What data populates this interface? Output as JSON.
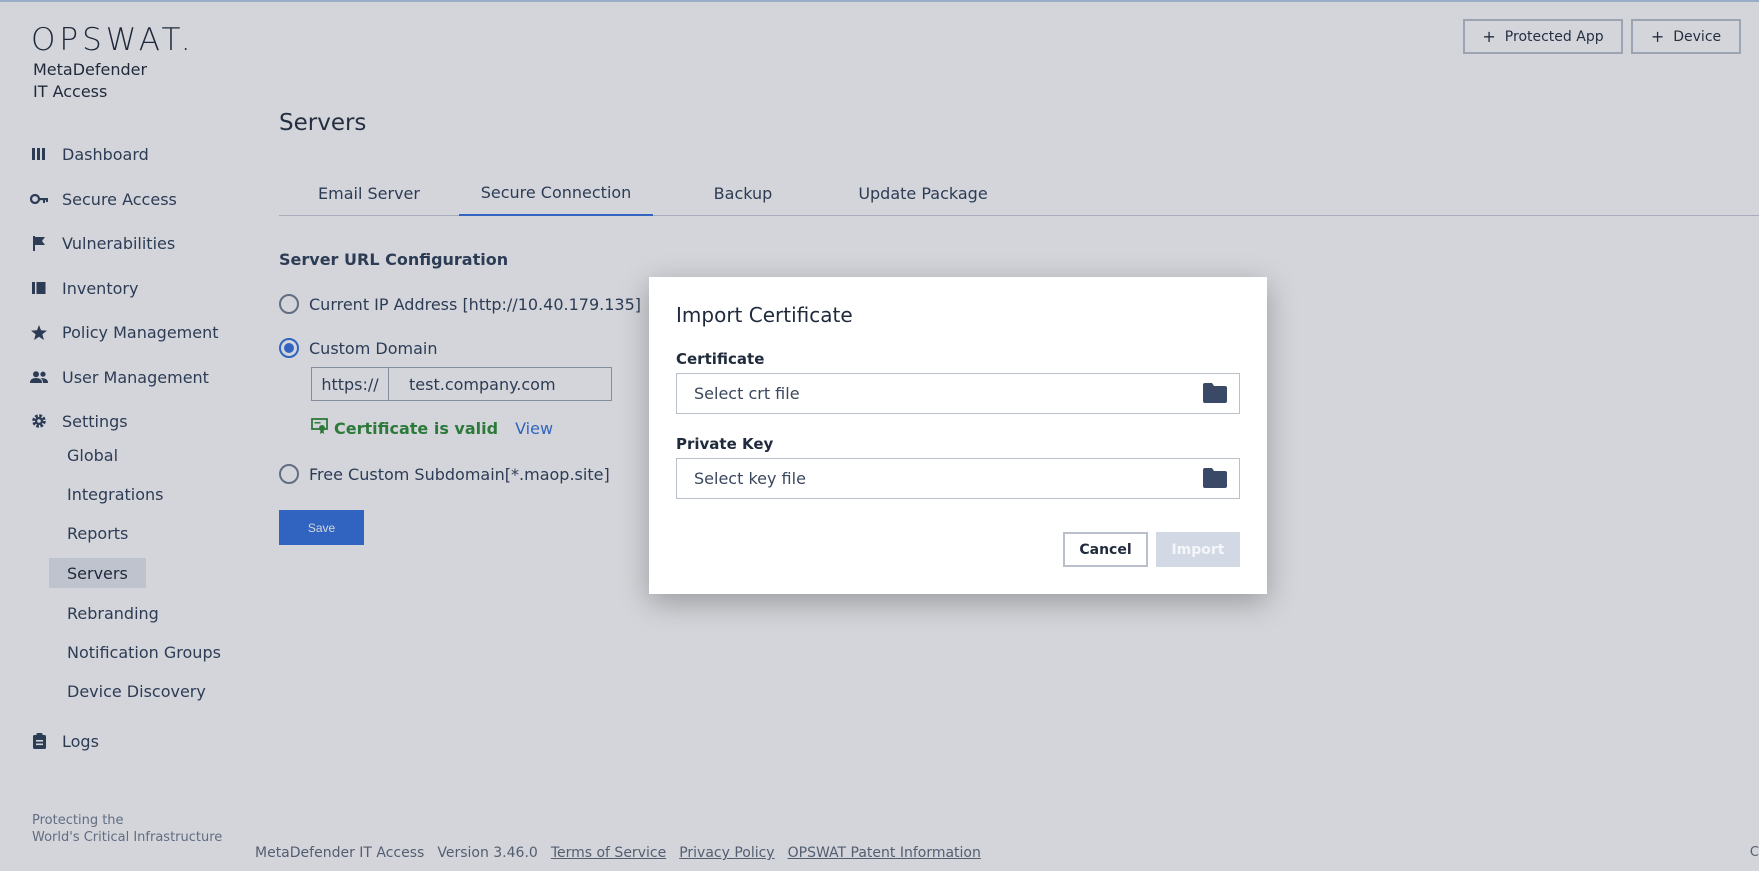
{
  "brand": {
    "logo": "OPSWAT.",
    "product_line1": "MetaDefender",
    "product_line2": "IT Access",
    "tagline_line1": "Protecting the",
    "tagline_line2": "World's Critical Infrastructure"
  },
  "sidebar": {
    "items": [
      {
        "label": "Dashboard",
        "icon": "dashboard-icon"
      },
      {
        "label": "Secure Access",
        "icon": "key-icon"
      },
      {
        "label": "Vulnerabilities",
        "icon": "flag-icon"
      },
      {
        "label": "Inventory",
        "icon": "inventory-icon"
      },
      {
        "label": "Policy Management",
        "icon": "star-icon"
      },
      {
        "label": "User Management",
        "icon": "users-icon"
      },
      {
        "label": "Settings",
        "icon": "gear-icon"
      }
    ],
    "settings_children": [
      "Global",
      "Integrations",
      "Reports",
      "Servers",
      "Rebranding",
      "Notification Groups",
      "Device Discovery"
    ],
    "active_child": "Servers",
    "logs": {
      "label": "Logs",
      "icon": "clipboard-icon"
    }
  },
  "header": {
    "protected_app_label": "Protected App",
    "device_label": "Device"
  },
  "main": {
    "title": "Servers",
    "tabs": [
      {
        "label": "Email Server"
      },
      {
        "label": "Secure Connection"
      },
      {
        "label": "Backup"
      },
      {
        "label": "Update Package"
      }
    ],
    "active_tab": "Secure Connection",
    "section_title": "Server URL Configuration",
    "options": {
      "current_ip": "Current IP Address [http://10.40.179.135]",
      "custom_domain": "Custom Domain",
      "free_subdomain": "Free Custom Subdomain[*.maop.site]"
    },
    "selected_option": "Custom Domain",
    "url_prefix": "https://",
    "domain_value": "test.company.com",
    "cert_status": "Certificate is valid",
    "view_link": "View",
    "save_label": "Save"
  },
  "modal": {
    "title": "Import Certificate",
    "certificate_label": "Certificate",
    "certificate_placeholder": "Select crt file",
    "private_key_label": "Private Key",
    "private_key_placeholder": "Select key file",
    "cancel_label": "Cancel",
    "import_label": "Import"
  },
  "footer": {
    "product": "MetaDefender IT Access",
    "version": "Version 3.46.0",
    "terms": "Terms of Service",
    "privacy": "Privacy Policy",
    "patent": "OPSWAT Patent Information",
    "corner": "C"
  },
  "colors": {
    "accent": "#2f6fde",
    "success": "#2a8a33",
    "overlay": "rgba(56,66,88,0.22)"
  }
}
